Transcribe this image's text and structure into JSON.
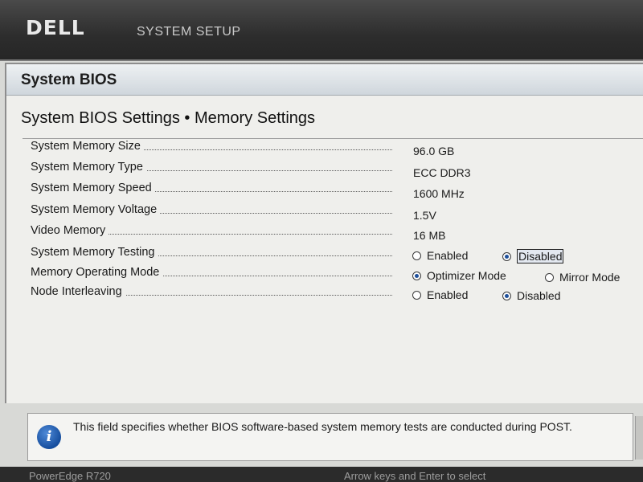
{
  "header": {
    "logo": "DELL",
    "app_title": "SYSTEM SETUP"
  },
  "panel": {
    "title": "System BIOS",
    "breadcrumb": "System BIOS Settings • Memory Settings"
  },
  "settings": [
    {
      "label": "System Memory Size",
      "value": "96.0 GB"
    },
    {
      "label": "System Memory Type",
      "value": "ECC DDR3"
    },
    {
      "label": "System Memory Speed",
      "value": "1600 MHz"
    },
    {
      "label": "System Memory Voltage",
      "value": "1.5V"
    },
    {
      "label": "Video Memory",
      "value": "16 MB"
    },
    {
      "label": "System Memory Testing",
      "options": [
        "Enabled",
        "Disabled"
      ],
      "selected": "Disabled"
    },
    {
      "label": "Memory Operating Mode",
      "options": [
        "Optimizer Mode",
        "Mirror Mode"
      ],
      "selected": "Optimizer Mode"
    },
    {
      "label": "Node Interleaving",
      "options": [
        "Enabled",
        "Disabled"
      ],
      "selected": "Disabled"
    }
  ],
  "help": {
    "icon": "info-icon",
    "text": "This field specifies whether BIOS software-based system memory tests are conducted during POST."
  },
  "footer": {
    "model": "PowerEdge R720",
    "hint": "Arrow keys and Enter to select"
  },
  "colors": {
    "header_bg": "#2d2d2d",
    "panel_bg": "#efefec",
    "accent": "#1d4f9a"
  }
}
